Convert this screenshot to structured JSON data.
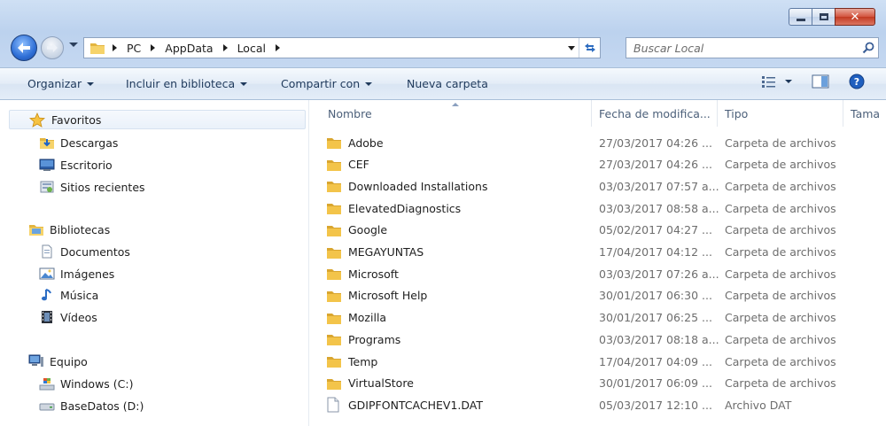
{
  "window": {
    "caption_buttons": {
      "minimize": "",
      "maximize": "",
      "close": "✕"
    }
  },
  "address_bar": {
    "path": [
      "PC",
      "AppData",
      "Local"
    ]
  },
  "search": {
    "placeholder": "Buscar Local"
  },
  "toolbar": {
    "organize": "Organizar",
    "include_library": "Incluir en biblioteca",
    "share_with": "Compartir con",
    "new_folder": "Nueva carpeta"
  },
  "sidebar": {
    "favorites": {
      "header": "Favoritos",
      "items": [
        "Descargas",
        "Escritorio",
        "Sitios recientes"
      ]
    },
    "libraries": {
      "header": "Bibliotecas",
      "items": [
        "Documentos",
        "Imágenes",
        "Música",
        "Vídeos"
      ]
    },
    "computer": {
      "header": "Equipo",
      "items": [
        "Windows (C:)",
        "BaseDatos (D:)"
      ]
    }
  },
  "columns": {
    "name": "Nombre",
    "date": "Fecha de modifica...",
    "type": "Tipo",
    "size": "Tama"
  },
  "files": [
    {
      "name": "Adobe",
      "date": "27/03/2017 04:26 ...",
      "type": "Carpeta de archivos",
      "icon": "folder-icon"
    },
    {
      "name": "CEF",
      "date": "27/03/2017 04:26 ...",
      "type": "Carpeta de archivos",
      "icon": "folder-icon"
    },
    {
      "name": "Downloaded Installations",
      "date": "03/03/2017 07:57 a...",
      "type": "Carpeta de archivos",
      "icon": "folder-icon"
    },
    {
      "name": "ElevatedDiagnostics",
      "date": "03/03/2017 08:58 a...",
      "type": "Carpeta de archivos",
      "icon": "folder-icon"
    },
    {
      "name": "Google",
      "date": "05/02/2017 04:27 ...",
      "type": "Carpeta de archivos",
      "icon": "folder-icon"
    },
    {
      "name": "MEGAYUNTAS",
      "date": "17/04/2017 04:12 ...",
      "type": "Carpeta de archivos",
      "icon": "folder-icon"
    },
    {
      "name": "Microsoft",
      "date": "03/03/2017 07:26 a...",
      "type": "Carpeta de archivos",
      "icon": "folder-icon"
    },
    {
      "name": "Microsoft Help",
      "date": "30/01/2017 06:30 ...",
      "type": "Carpeta de archivos",
      "icon": "folder-icon"
    },
    {
      "name": "Mozilla",
      "date": "30/01/2017 06:25 ...",
      "type": "Carpeta de archivos",
      "icon": "folder-icon"
    },
    {
      "name": "Programs",
      "date": "03/03/2017 08:18 a...",
      "type": "Carpeta de archivos",
      "icon": "folder-icon"
    },
    {
      "name": "Temp",
      "date": "17/04/2017 04:09 ...",
      "type": "Carpeta de archivos",
      "icon": "folder-icon"
    },
    {
      "name": "VirtualStore",
      "date": "30/01/2017 06:09 ...",
      "type": "Carpeta de archivos",
      "icon": "folder-icon"
    },
    {
      "name": "GDIPFONTCACHEV1.DAT",
      "date": "05/03/2017 12:10 ...",
      "type": "Archivo DAT",
      "icon": "file-icon"
    }
  ],
  "colors": {
    "title_bar": "#c5d8f1",
    "command_bar": "#e3ecf7",
    "text_primary": "#1e1e1e",
    "text_secondary": "#6d6d6d",
    "folder_yellow": "#f3c44a"
  }
}
